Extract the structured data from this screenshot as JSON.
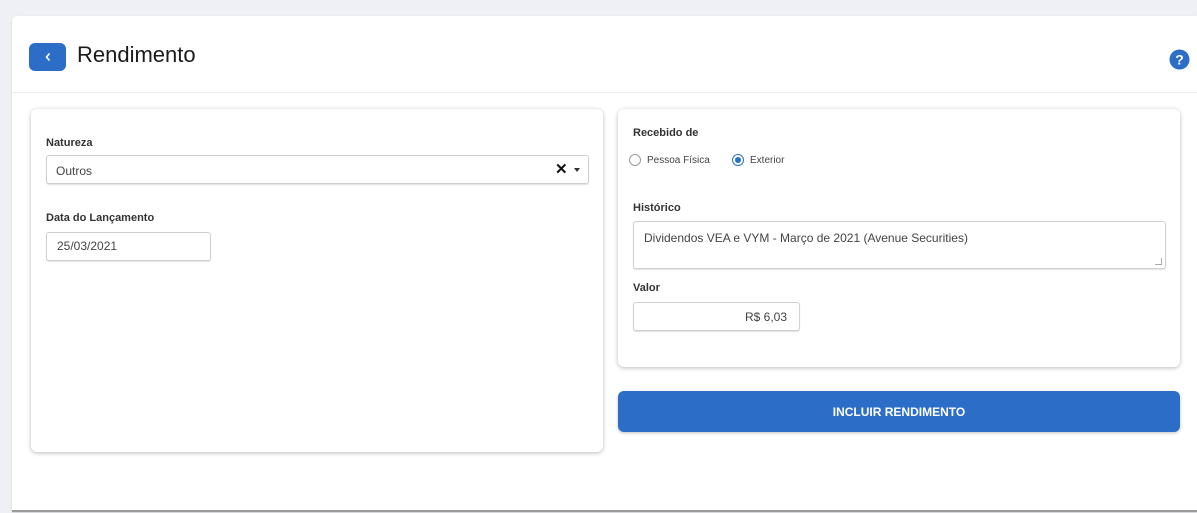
{
  "header": {
    "title": "Rendimento",
    "back_icon": "chevron-left-icon",
    "help_icon": "question-circle-icon"
  },
  "left_card": {
    "natureza_label": "Natureza",
    "natureza_value": "Outros",
    "data_label": "Data do Lançamento",
    "data_value": "25/03/2021"
  },
  "right_card": {
    "recebido_label": "Recebido de",
    "options": [
      {
        "label": "Pessoa Física",
        "selected": false
      },
      {
        "label": "Exterior",
        "selected": true
      }
    ],
    "historico_label": "Histórico",
    "historico_value": "Dividendos VEA e VYM - Março de 2021 (Avenue Securities)",
    "valor_label": "Valor",
    "valor_value": "R$ 6,03"
  },
  "actions": {
    "submit_label": "INCLUIR RENDIMENTO"
  },
  "colors": {
    "accent": "#2c6ec7",
    "background": "#eef0f5"
  }
}
